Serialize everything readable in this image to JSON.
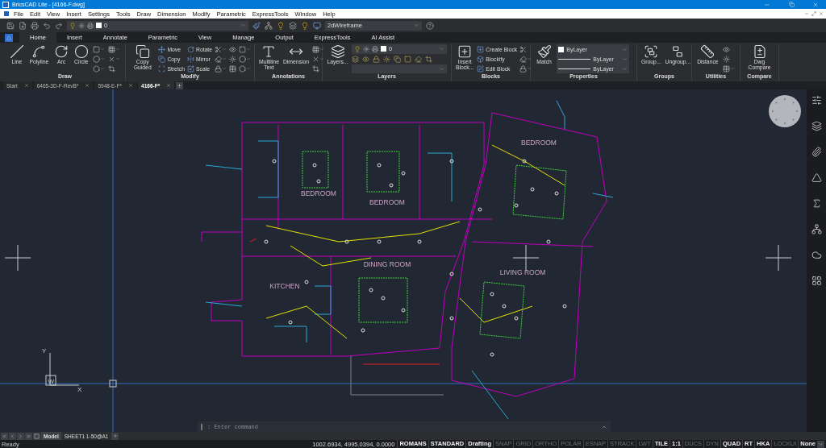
{
  "window": {
    "title": "BricsCAD Lite - [4166-F.dwg]"
  },
  "menu_bar": [
    "File",
    "Edit",
    "View",
    "Insert",
    "Settings",
    "Tools",
    "Draw",
    "Dimension",
    "Modify",
    "Parametric",
    "ExpressTools",
    "Window",
    "Help"
  ],
  "quick_access": {
    "layer": "0",
    "visual_style": "2dWireframe"
  },
  "ribbon": {
    "tabs": [
      {
        "label": "Home",
        "selected": true
      },
      {
        "label": "Insert",
        "selected": false
      },
      {
        "label": "Annotate",
        "selected": false
      },
      {
        "label": "Parametric",
        "selected": false
      },
      {
        "label": "View",
        "selected": false
      },
      {
        "label": "Manage",
        "selected": false
      },
      {
        "label": "Output",
        "selected": false
      },
      {
        "label": "ExpressTools",
        "selected": false
      },
      {
        "label": "AI Assist",
        "selected": false
      }
    ],
    "panels": [
      {
        "title": "Draw",
        "items": [
          {
            "kind": "large",
            "label": "Line"
          },
          {
            "kind": "large",
            "label": "Polyline"
          },
          {
            "kind": "large",
            "label": "Arc"
          },
          {
            "kind": "large",
            "label": "Circle"
          },
          {
            "kind": "tool",
            "menu": true
          },
          {
            "kind": "tool",
            "menu": true
          },
          {
            "kind": "tool",
            "menu": true
          },
          {
            "kind": "tool",
            "menu": true
          },
          {
            "kind": "tool",
            "menu": true
          },
          {
            "kind": "tool",
            "menu": false
          }
        ]
      },
      {
        "title": "Modify",
        "items": [
          {
            "kind": "large",
            "label": "Copy Guided"
          },
          {
            "kind": "small",
            "label": "Move"
          },
          {
            "kind": "small",
            "label": "Copy"
          },
          {
            "kind": "small",
            "label": "Stretch"
          },
          {
            "kind": "small",
            "label": "Rotate"
          },
          {
            "kind": "small",
            "label": "Mirror"
          },
          {
            "kind": "small",
            "label": "Scale"
          },
          {
            "kind": "tool",
            "menu": true
          },
          {
            "kind": "tool",
            "menu": true
          },
          {
            "kind": "tool",
            "menu": true
          },
          {
            "kind": "tool",
            "menu": false
          },
          {
            "kind": "tool",
            "menu": false
          },
          {
            "kind": "tool",
            "menu": false
          },
          {
            "kind": "tool",
            "menu": true
          },
          {
            "kind": "tool",
            "menu": true
          },
          {
            "kind": "tool",
            "menu": true
          }
        ]
      },
      {
        "title": "Annotations",
        "items": [
          {
            "kind": "large",
            "label": "Multiline Text"
          },
          {
            "kind": "large",
            "label": "Dimension"
          },
          {
            "kind": "tool",
            "menu": true
          },
          {
            "kind": "tool",
            "menu": true
          },
          {
            "kind": "tool",
            "menu": false
          }
        ]
      },
      {
        "title": "Layers",
        "items": [
          {
            "kind": "large",
            "label": "Layers..."
          },
          {
            "kind": "layer_combo",
            "value": "0"
          }
        ]
      },
      {
        "title": "Blocks",
        "items": [
          {
            "kind": "large",
            "label": "Insert Block..."
          },
          {
            "kind": "small",
            "label": "Create Block"
          },
          {
            "kind": "small",
            "label": "Blockify"
          },
          {
            "kind": "small",
            "label": "Edit Block"
          },
          {
            "kind": "tool",
            "menu": false
          },
          {
            "kind": "tool",
            "menu": true
          },
          {
            "kind": "tool",
            "menu": true
          }
        ]
      },
      {
        "title": "Properties",
        "items": [
          {
            "kind": "large",
            "label": "Match"
          },
          {
            "kind": "color_combo",
            "value": "ByLayer"
          },
          {
            "kind": "line_combo",
            "value": "ByLayer"
          },
          {
            "kind": "line_combo",
            "value": "ByLayer"
          }
        ]
      },
      {
        "title": "Groups",
        "items": [
          {
            "kind": "large",
            "label": "Group..."
          },
          {
            "kind": "large",
            "label": "Ungroup..."
          }
        ]
      },
      {
        "title": "Utilities",
        "items": [
          {
            "kind": "large",
            "label": "Distance"
          },
          {
            "kind": "tool",
            "menu": false
          },
          {
            "kind": "tool",
            "menu": false
          },
          {
            "kind": "tool",
            "menu": true
          }
        ]
      },
      {
        "title": "Compare",
        "items": [
          {
            "kind": "large",
            "label": "Dwg Compare"
          }
        ]
      }
    ]
  },
  "document_tabs": [
    {
      "label": "Start",
      "selected": false
    },
    {
      "label": "6465-3D-F-RevB*",
      "selected": false
    },
    {
      "label": "5948-E-F*",
      "selected": false
    },
    {
      "label": "4166-F*",
      "selected": true
    }
  ],
  "drawing": {
    "room_labels": [
      "BEDROOM",
      "BEDROOM",
      "BEDROOM",
      "DINING ROOM",
      "KITCHEN",
      "LIVING ROOM"
    ],
    "ucs": {
      "x_label": "X",
      "y_label": "Y",
      "w_label": "W"
    }
  },
  "command_line": {
    "placeholder": ": Enter command"
  },
  "layout_tabs": [
    {
      "label": "Model",
      "selected": true
    },
    {
      "label": "SHEET1 1-50@A1",
      "selected": false
    }
  ],
  "status_bar": {
    "message": "Ready",
    "coordinates": "1002.6934, 4995.0394, 0.0000",
    "toggles": [
      {
        "label": "ROMANS",
        "on": true
      },
      {
        "label": "STANDARD",
        "on": true
      },
      {
        "label": "Drafting",
        "on": true
      },
      {
        "label": "SNAP",
        "on": false
      },
      {
        "label": "GRID",
        "on": false
      },
      {
        "label": "ORTHO",
        "on": false
      },
      {
        "label": "POLAR",
        "on": false
      },
      {
        "label": "ESNAP",
        "on": false
      },
      {
        "label": "STRACK",
        "on": false
      },
      {
        "label": "LWT",
        "on": false
      },
      {
        "label": "TILE",
        "on": true
      },
      {
        "label": "1:1",
        "on": true
      },
      {
        "label": "DUCS",
        "on": false
      },
      {
        "label": "DYN",
        "on": false
      },
      {
        "label": "QUAD",
        "on": true
      },
      {
        "label": "RT",
        "on": true
      },
      {
        "label": "HKA",
        "on": true
      },
      {
        "label": "LOCKUI",
        "on": false
      },
      {
        "label": "None",
        "on": true
      }
    ]
  }
}
